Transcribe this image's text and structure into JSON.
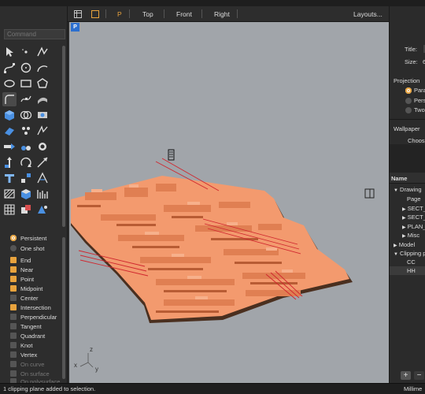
{
  "command": {
    "placeholder": "Command"
  },
  "viewport_tabs": {
    "perspective": "P",
    "top": "Top",
    "front": "Front",
    "right": "Right",
    "layouts": "Layouts..."
  },
  "viewport": {
    "badge": "P",
    "axis_z": "z",
    "axis_x": "x",
    "axis_y": "y"
  },
  "osnap": {
    "modes": [
      {
        "label": "Persistent",
        "kind": "radio",
        "on": true
      },
      {
        "label": "One shot",
        "kind": "radio",
        "on": false
      }
    ],
    "snaps": [
      {
        "label": "End",
        "on": true
      },
      {
        "label": "Near",
        "on": true
      },
      {
        "label": "Point",
        "on": true
      },
      {
        "label": "Midpoint",
        "on": true
      },
      {
        "label": "Center",
        "on": false
      },
      {
        "label": "Intersection",
        "on": true
      },
      {
        "label": "Perpendicular",
        "on": false
      },
      {
        "label": "Tangent",
        "on": false
      },
      {
        "label": "Quadrant",
        "on": false
      },
      {
        "label": "Knot",
        "on": false
      },
      {
        "label": "Vertex",
        "on": false
      },
      {
        "label": "On curve",
        "on": false
      },
      {
        "label": "On surface",
        "on": false
      },
      {
        "label": "On polysurface",
        "on": false
      }
    ]
  },
  "properties": {
    "title_label": "Title:",
    "size_label": "Size:",
    "size_value": "6",
    "projection_label": "Projection",
    "projection_options": [
      "Para",
      "Pers",
      "Two"
    ],
    "wallpaper_label": "Wallpaper",
    "choose_label": "Choos"
  },
  "layout_tree": {
    "header": "Name",
    "items": [
      "Drawing",
      "Page",
      "SECT_",
      "SECT_",
      "PLAN_",
      "Misc",
      "Model",
      "Clipping p",
      "CC",
      "HH"
    ],
    "add_label": "+",
    "remove_label": "−"
  },
  "status": {
    "message": "1 clipping plane added to selection.",
    "units": "Millime"
  },
  "colors": {
    "accent": "#e8a33d",
    "model_fill": "#f39a6e",
    "clip_line": "#d0262e",
    "viewport_bg": "#a1a5aa"
  }
}
